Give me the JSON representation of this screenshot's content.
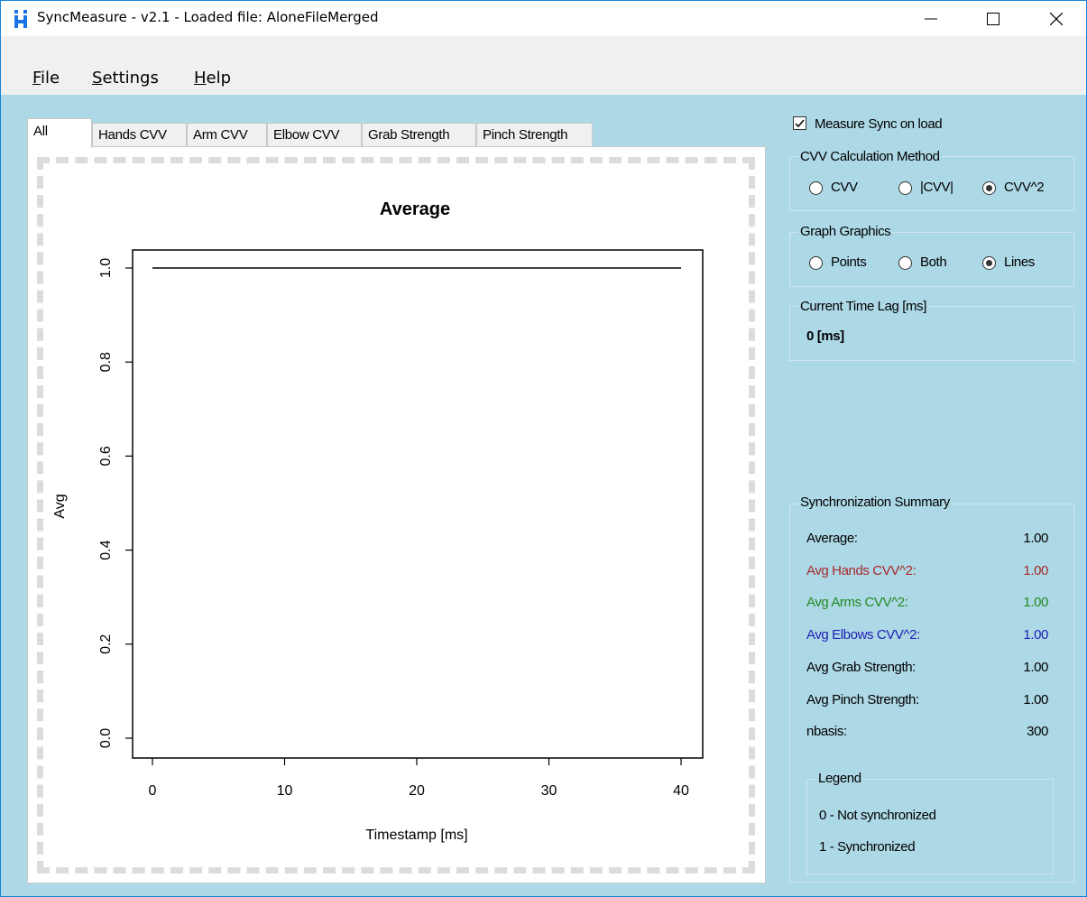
{
  "window": {
    "title": "SyncMeasure - v2.1 - Loaded file: AloneFileMerged",
    "controls": [
      "minimize-icon",
      "maximize-icon",
      "close-icon"
    ]
  },
  "menu": {
    "file": {
      "accel": "F",
      "rest": "ile"
    },
    "settings": {
      "accel": "S",
      "rest": "ettings"
    },
    "help": {
      "accel": "H",
      "rest": "elp"
    }
  },
  "tabs": [
    "All",
    "Hands CVV",
    "Arm CVV",
    "Elbow CVV",
    "Grab Strength",
    "Pinch Strength"
  ],
  "active_tab": "All",
  "options": {
    "measure_sync_label": "Measure Sync on load",
    "measure_sync_checked": true,
    "cvv_method": {
      "title": "CVV Calculation Method",
      "options": [
        "CVV",
        "|CVV|",
        "CVV^2"
      ],
      "selected": "CVV^2"
    },
    "graph_graphics": {
      "title": "Graph Graphics",
      "options": [
        "Points",
        "Both",
        "Lines"
      ],
      "selected": "Lines"
    },
    "time_lag": {
      "title": "Current Time Lag [ms]",
      "value": "0 [ms]"
    }
  },
  "summary": {
    "title": "Synchronization Summary",
    "rows": [
      {
        "label": "Average:",
        "value": "1.00",
        "color": "#000000"
      },
      {
        "label": "Avg Hands CVV^2:",
        "value": "1.00",
        "color": "#a52a2a"
      },
      {
        "label": "Avg Arms CVV^2:",
        "value": "1.00",
        "color": "#228b22"
      },
      {
        "label": "Avg Elbows CVV^2:",
        "value": "1.00",
        "color": "#1e1eb4"
      },
      {
        "label": "Avg Grab Strength:",
        "value": "1.00",
        "color": "#000000"
      },
      {
        "label": "Avg Pinch Strength:",
        "value": "1.00",
        "color": "#000000"
      },
      {
        "label": "nbasis:",
        "value": "300",
        "color": "#000000"
      }
    ],
    "legend": {
      "title": "Legend",
      "items": [
        "0 - Not synchronized",
        "1 - Synchronized"
      ]
    }
  },
  "chart_data": {
    "type": "line",
    "title": "Average",
    "xlabel": "Timestamp [ms]",
    "ylabel": "Avg",
    "xlim": [
      0,
      40
    ],
    "ylim": [
      0,
      1
    ],
    "xticks": [
      "0",
      "10",
      "20",
      "30",
      "40"
    ],
    "yticks": [
      "0.0",
      "0.2",
      "0.4",
      "0.6",
      "0.8",
      "1.0"
    ],
    "x": [
      0,
      40
    ],
    "y": [
      1.0,
      1.0
    ],
    "grid": false
  }
}
